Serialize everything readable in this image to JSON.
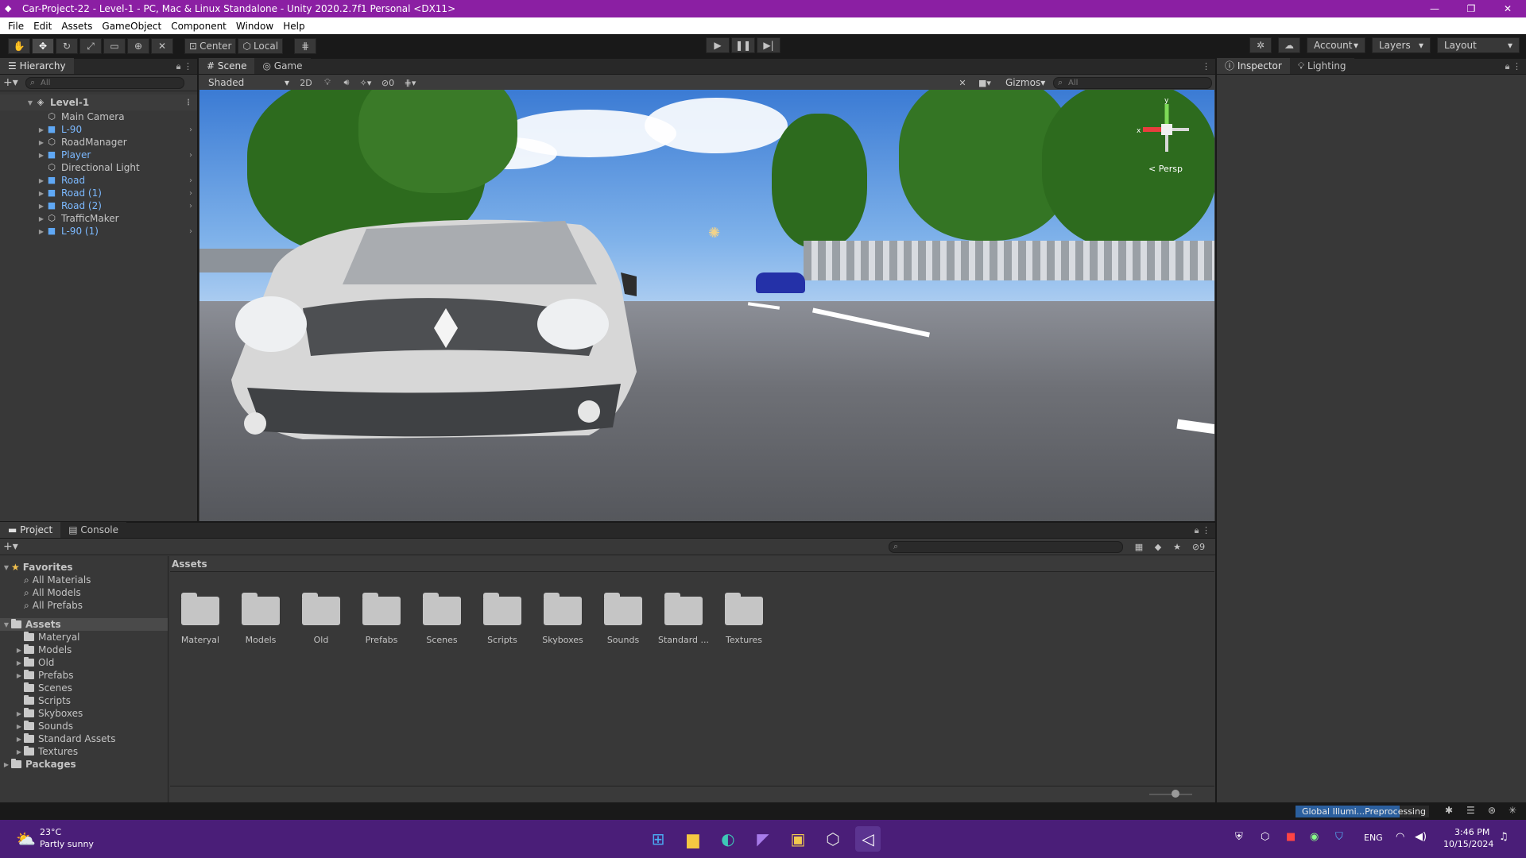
{
  "window": {
    "title": "Car-Project-22 - Level-1 - PC, Mac & Linux Standalone - Unity 2020.2.7f1 Personal <DX11>",
    "min": "—",
    "max": "❐",
    "close": "✕"
  },
  "menu": [
    "File",
    "Edit",
    "Assets",
    "GameObject",
    "Component",
    "Window",
    "Help"
  ],
  "toolbar": {
    "center": "Center",
    "local": "Local",
    "account": "Account",
    "layers": "Layers",
    "layout": "Layout"
  },
  "hierarchy": {
    "tab": "Hierarchy",
    "search_placeholder": "All",
    "scene": "Level-1",
    "items": [
      {
        "label": "Main Camera",
        "prefab": false,
        "expand": false
      },
      {
        "label": "L-90",
        "prefab": true,
        "expand": true
      },
      {
        "label": "RoadManager",
        "prefab": false,
        "expand": true
      },
      {
        "label": "Player",
        "prefab": true,
        "expand": true
      },
      {
        "label": "Directional Light",
        "prefab": false,
        "expand": false
      },
      {
        "label": "Road",
        "prefab": true,
        "expand": true
      },
      {
        "label": "Road (1)",
        "prefab": true,
        "expand": true
      },
      {
        "label": "Road (2)",
        "prefab": true,
        "expand": true
      },
      {
        "label": "TrafficMaker",
        "prefab": false,
        "expand": true
      },
      {
        "label": "L-90 (1)",
        "prefab": true,
        "expand": true
      }
    ]
  },
  "scene": {
    "tab_scene": "Scene",
    "tab_game": "Game",
    "shading": "Shaded",
    "mode2d": "2D",
    "hidden_count": "0",
    "gizmos": "Gizmos",
    "search_placeholder": "All",
    "persp": "< Persp",
    "axis_x": "x",
    "axis_y": "y"
  },
  "inspector": {
    "tab": "Inspector",
    "lighting": "Lighting"
  },
  "project": {
    "tab": "Project",
    "console": "Console",
    "hidden_count": "9",
    "breadcrumb": "Assets",
    "favorites_label": "Favorites",
    "favorites": [
      "All Materials",
      "All Models",
      "All Prefabs"
    ],
    "assets_label": "Assets",
    "asset_folders": [
      "Materyal",
      "Models",
      "Old",
      "Prefabs",
      "Scenes",
      "Scripts",
      "Skyboxes",
      "Sounds",
      "Standard Assets",
      "Textures"
    ],
    "grid_folders": [
      "Materyal",
      "Models",
      "Old",
      "Prefabs",
      "Scenes",
      "Scripts",
      "Skyboxes",
      "Sounds",
      "Standard ...",
      "Textures"
    ],
    "packages_label": "Packages"
  },
  "status": {
    "progress_text": "Global Illumi...Preprocessing"
  },
  "taskbar": {
    "temp": "23°C",
    "weather": "Partly sunny",
    "lang": "ENG",
    "time": "3:46 PM",
    "date": "10/15/2024"
  }
}
